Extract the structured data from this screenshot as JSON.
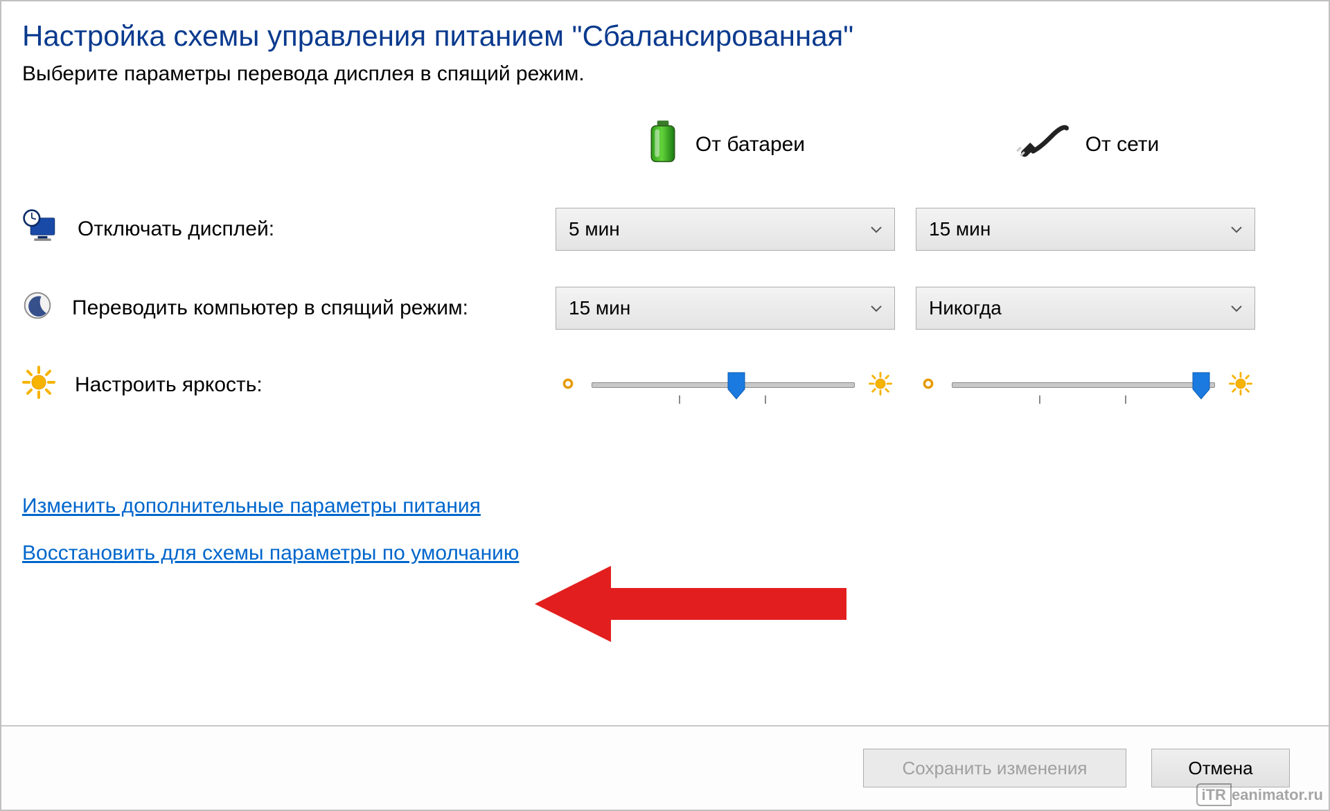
{
  "header": {
    "title": "Настройка схемы управления питанием \"Сбалансированная\"",
    "subtitle": "Выберите параметры перевода дисплея в спящий режим."
  },
  "columns": {
    "battery_label": "От батареи",
    "ac_label": "От сети"
  },
  "rows": {
    "display_off": {
      "label": "Отключать дисплей:",
      "battery_value": "5 мин",
      "ac_value": "15 мин"
    },
    "sleep": {
      "label": "Переводить компьютер в спящий режим:",
      "battery_value": "15 мин",
      "ac_value": "Никогда"
    },
    "brightness": {
      "label": "Настроить яркость:",
      "battery_percent": 55,
      "ac_percent": 95
    }
  },
  "links": {
    "advanced": "Изменить дополнительные параметры питания",
    "restore_defaults": "Восстановить для схемы параметры по умолчанию"
  },
  "footer": {
    "save_label": "Сохранить изменения",
    "cancel_label": "Отмена"
  },
  "watermark": "iTReanimator.ru",
  "colors": {
    "accent_link": "#0066cc",
    "title": "#0a3a8e",
    "arrow": "#e31e1e"
  }
}
